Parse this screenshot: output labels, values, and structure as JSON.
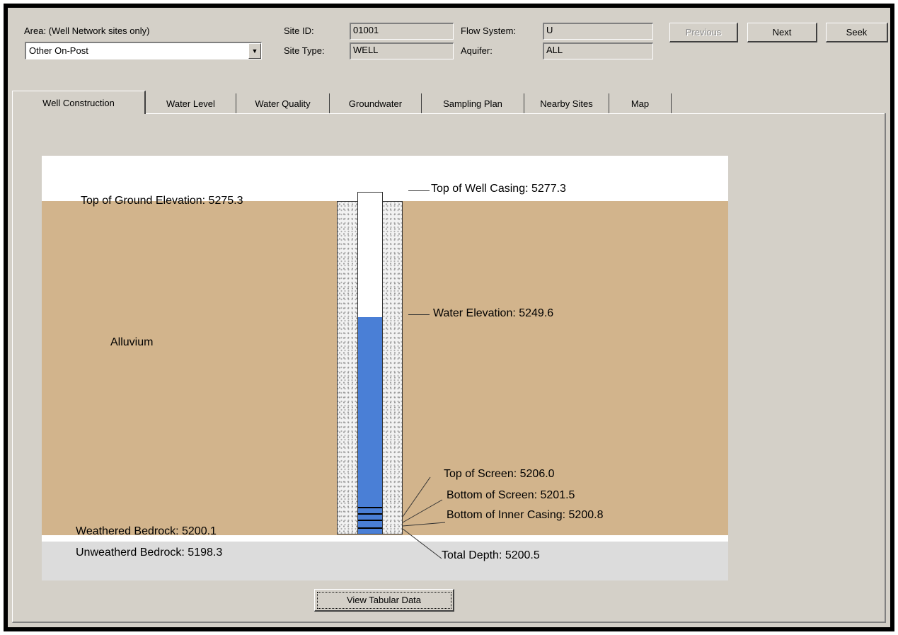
{
  "header": {
    "area_label": "Area: (Well Network sites only)",
    "area_value": "Other On-Post",
    "site_id_label": "Site ID:",
    "site_id_value": "01001",
    "site_type_label": "Site Type:",
    "site_type_value": "WELL",
    "flow_system_label": "Flow System:",
    "flow_system_value": "U",
    "aquifer_label": "Aquifer:",
    "aquifer_value": "ALL",
    "previous_button": "Previous",
    "next_button": "Next",
    "seek_button": "Seek"
  },
  "tabs": [
    {
      "label": "Well Construction",
      "active": true
    },
    {
      "label": "Water Level"
    },
    {
      "label": "Water Quality"
    },
    {
      "label": "Groundwater"
    },
    {
      "label": "Sampling Plan"
    },
    {
      "label": "Nearby Sites"
    },
    {
      "label": "Map"
    }
  ],
  "diagram": {
    "top_of_ground": "Top of Ground Elevation:  5275.3",
    "top_of_casing": "Top of Well Casing:  5277.3",
    "water_elevation": "Water Elevation:  5249.6",
    "alluvium": "Alluvium",
    "top_of_screen": "Top of Screen:  5206.0",
    "bottom_of_screen": "Bottom of Screen:  5201.5",
    "bottom_inner_casing": "Bottom of Inner Casing:  5200.8",
    "weathered_bedrock": "Weathered Bedrock:  5200.1",
    "unweathered_bedrock": "Unweatherd Bedrock:  5198.3",
    "total_depth": "Total Depth:  5200.5",
    "colors": {
      "alluvium": "#d2b48c",
      "water": "#4a7fd6",
      "bedrock": "#dcdcdc"
    }
  },
  "view_tabular_button": "View Tabular Data"
}
